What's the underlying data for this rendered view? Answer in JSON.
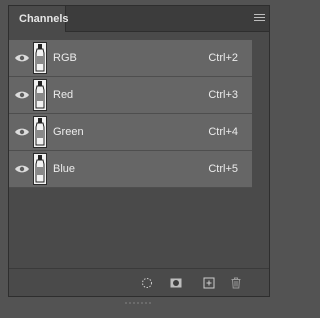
{
  "panel": {
    "tab_label": "Channels",
    "menu_icon": "panel-menu-icon"
  },
  "channels": [
    {
      "label": "RGB",
      "shortcut": "Ctrl+2",
      "icon": "eye-icon"
    },
    {
      "label": "Red",
      "shortcut": "Ctrl+3",
      "icon": "eye-icon"
    },
    {
      "label": "Green",
      "shortcut": "Ctrl+4",
      "icon": "eye-icon"
    },
    {
      "label": "Blue",
      "shortcut": "Ctrl+5",
      "icon": "eye-icon"
    }
  ],
  "footer": {
    "icons": [
      "load-selection-icon",
      "save-selection-as-channel-icon",
      "new-channel-icon",
      "delete-channel-icon"
    ]
  },
  "colors": {
    "panel_bg": "#4a4a4a",
    "row_bg": "#666666",
    "text": "#ececec"
  }
}
